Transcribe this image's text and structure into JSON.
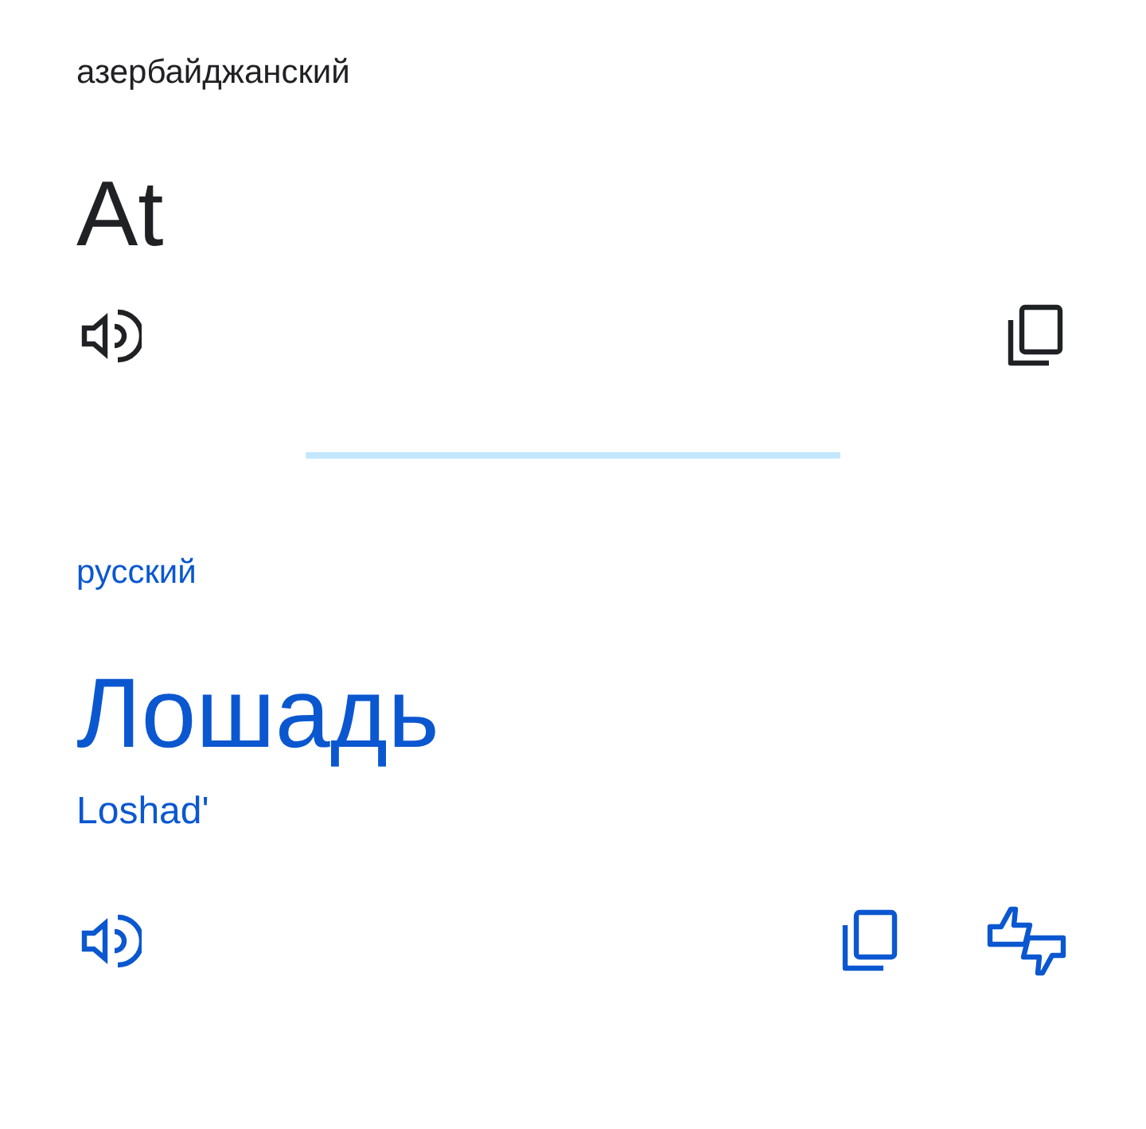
{
  "source": {
    "language": "азербайджанский",
    "text": "At"
  },
  "target": {
    "language": "русский",
    "text": "Лошадь",
    "transliteration": "Loshad'"
  }
}
